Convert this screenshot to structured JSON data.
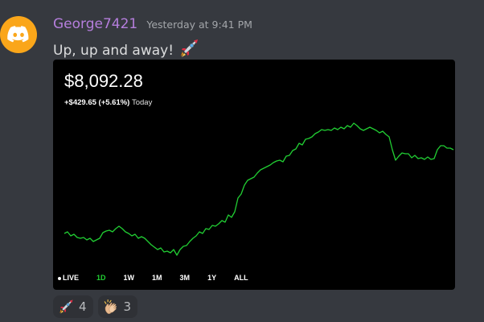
{
  "message": {
    "author": "George7421",
    "timestamp": "Yesterday at 9:41 PM",
    "text": "Up, up and away!",
    "inline_emoji": "rocket-emoji",
    "avatar_icon": "discord-logo-icon",
    "author_color": "#b57edc",
    "avatar_color": "#faa61a"
  },
  "embed": {
    "price": "$8,092.28",
    "change": "+$429.65 (+5.61%)",
    "period": "Today",
    "ranges": [
      "LIVE",
      "1D",
      "1W",
      "1M",
      "3M",
      "1Y",
      "ALL"
    ],
    "active_range": "1D",
    "line_color": "#21ce33"
  },
  "reactions": [
    {
      "emoji": "rocket",
      "count": "4"
    },
    {
      "emoji": "clapping-hands",
      "count": "3"
    }
  ]
}
